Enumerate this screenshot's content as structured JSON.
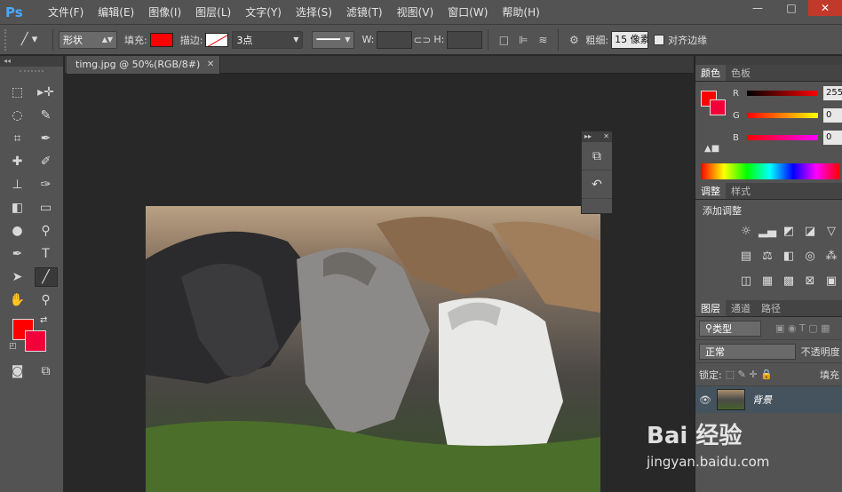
{
  "app": {
    "logo": "Ps"
  },
  "menu": [
    "文件(F)",
    "编辑(E)",
    "图像(I)",
    "图层(L)",
    "文字(Y)",
    "选择(S)",
    "滤镜(T)",
    "视图(V)",
    "窗口(W)",
    "帮助(H)"
  ],
  "window_controls": {
    "minimize": "—",
    "restore": "□",
    "close": "✕"
  },
  "options": {
    "mode": "形状",
    "fill_label": "填充:",
    "stroke_label": "描边:",
    "stroke_width": "3点",
    "w_label": "W:",
    "h_label": "H:",
    "weight_label": "粗细:",
    "weight_value": "15 像素",
    "align_edges": "对齐边缘",
    "fill_color": "#ff0000",
    "stroke_color": "#ffffff"
  },
  "document": {
    "tab_title": "timg.jpg @ 50%(RGB/8#)",
    "close": "✕"
  },
  "colors": {
    "foreground": "#ff0000",
    "background": "#f2003a"
  },
  "panels": {
    "color_tabs": [
      "颜色",
      "色板"
    ],
    "rgb": [
      {
        "label": "R",
        "value": "255"
      },
      {
        "label": "G",
        "value": "0"
      },
      {
        "label": "B",
        "value": "0"
      }
    ],
    "adjust_tabs": [
      "调整",
      "样式"
    ],
    "adjust_title": "添加调整",
    "layers_tabs": [
      "图层",
      "通道",
      "路径"
    ],
    "kind_filter": "类型",
    "blend_mode": "正常",
    "opacity_label": "不透明度",
    "lock_label": "锁定:",
    "fill_label": "填充",
    "layer_name": "背景"
  },
  "watermark": {
    "brand": "Bai 经验",
    "url": "jingyan.baidu.com"
  }
}
